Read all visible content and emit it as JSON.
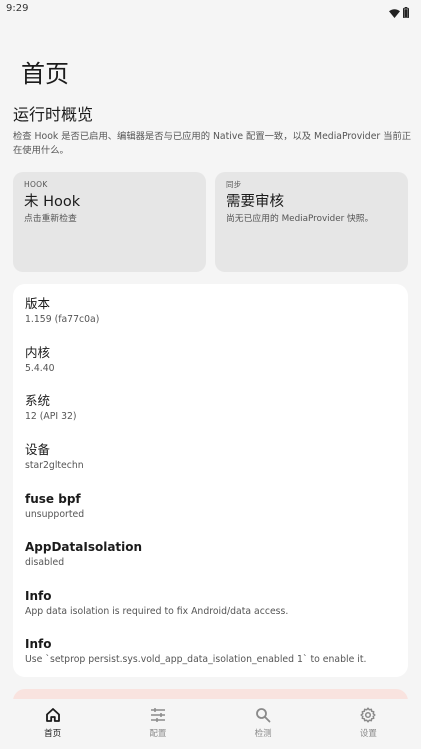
{
  "status_bar": {
    "time": "9:29",
    "icons": [
      "wifi-icon",
      "battery-icon"
    ]
  },
  "page": {
    "title": "首页"
  },
  "overview": {
    "title": "运行时概览",
    "description": "检查 Hook 是否已启用、编辑器是否与已应用的 Native 配置一致，以及 MediaProvider 当前正在使用什么。"
  },
  "cards": {
    "hook": {
      "overline": "HOOK",
      "headline": "未 Hook",
      "sub": "点击重新检查"
    },
    "sync": {
      "overline": "同步",
      "headline": "需要审核",
      "sub": "尚无已应用的 MediaProvider 快照。"
    }
  },
  "info": [
    {
      "label": "版本",
      "value": "1.159 (fa77c0a)"
    },
    {
      "label": "内核",
      "value": "5.4.40"
    },
    {
      "label": "系统",
      "value": "12 (API 32)"
    },
    {
      "label": "设备",
      "value": "star2gltechn"
    },
    {
      "label": "fuse bpf",
      "value": "unsupported"
    },
    {
      "label": "AppDataIsolation",
      "value": "disabled"
    },
    {
      "label": "Info",
      "value": "App data isolation is required to fix Android/data access."
    },
    {
      "label": "Info",
      "value": "Use `setprop persist.sys.vold_app_data_isolation_enabled 1` to enable it."
    }
  ],
  "bottom_nav": [
    {
      "label": "首页",
      "icon": "home-icon",
      "active": true
    },
    {
      "label": "配置",
      "icon": "sliders-icon",
      "active": false
    },
    {
      "label": "检测",
      "icon": "search-icon",
      "active": false
    },
    {
      "label": "设置",
      "icon": "gear-icon",
      "active": false
    }
  ],
  "colors": {
    "background": "#f5f5f5",
    "card": "#e6e6e6",
    "surface": "#ffffff",
    "peek_card": "#f9e3df",
    "nav_active": "#1b1b1b",
    "nav_inactive": "#8a8a8a"
  }
}
